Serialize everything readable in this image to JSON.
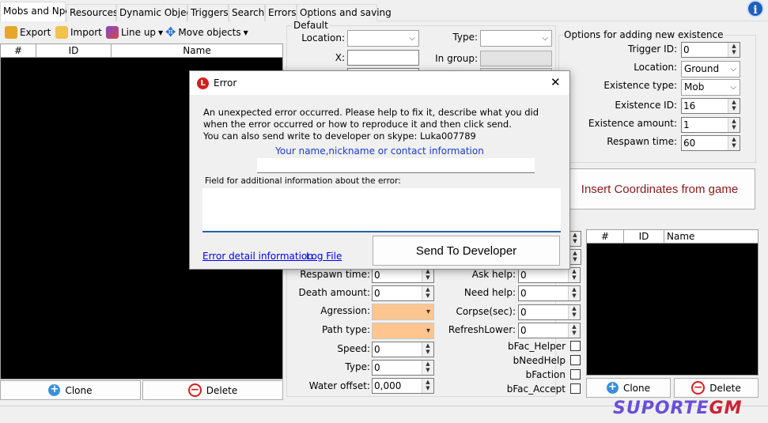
{
  "tabs": [
    {
      "label": "Mobs and Npcs",
      "active": true
    },
    {
      "label": "Resources"
    },
    {
      "label": "Dynamic Objects"
    },
    {
      "label": "Triggers"
    },
    {
      "label": "Search"
    },
    {
      "label": "Errors"
    },
    {
      "label": "Options and saving"
    }
  ],
  "info_icon": "i",
  "toolbar": {
    "export": "Export",
    "import": "Import",
    "line_up": "Line up",
    "move_objects": "Move objects"
  },
  "left_grid": {
    "headers": [
      "#",
      "ID",
      "Name"
    ]
  },
  "left_buttons": {
    "clone": "Clone",
    "delete": "Delete"
  },
  "default_group": {
    "title": "Default",
    "location_label": "Location:",
    "x_label": "X:",
    "type_label": "Type:",
    "in_group_label": "In group:"
  },
  "options_group": {
    "title": "Options for adding new existence",
    "trigger_id_label": "Trigger ID:",
    "trigger_id": "0",
    "location_label": "Location:",
    "location": "Ground",
    "existence_type_label": "Existence type:",
    "existence_type": "Mob",
    "existence_id_label": "Existence ID:",
    "existence_id": "16",
    "existence_amount_label": "Existence amount:",
    "existence_amount": "1",
    "respawn_time_label": "Respawn time:",
    "respawn_time": "60"
  },
  "insert_button": "Insert Coordinates from game",
  "right_grid": {
    "headers": [
      "#",
      "ID",
      "Name"
    ]
  },
  "right_buttons": {
    "clone": "Clone",
    "delete": "Delete"
  },
  "fields_left": {
    "respawn_time_label": "Respawn time:",
    "respawn_time": "0",
    "death_amount_label": "Death amount:",
    "death_amount": "0",
    "agression_label": "Agression:",
    "path_type_label": "Path type:",
    "speed_label": "Speed:",
    "speed": "0",
    "type_label": "Type:",
    "type": "0",
    "water_offset_label": "Water offset:",
    "water_offset": "0,000"
  },
  "fields_right": {
    "ask_help_label": "Ask help:",
    "ask_help": "0",
    "need_help_label": "Need help:",
    "need_help": "0",
    "corpse_label": "Corpse(sec):",
    "corpse": "0",
    "refresh_lower_label": "RefreshLower:",
    "refresh_lower": "0",
    "bfac_helper": "bFac_Helper",
    "bneed_help": "bNeedHelp",
    "bfaction": "bFaction",
    "bfac_accept": "bFac_Accept"
  },
  "dialog": {
    "title": "Error",
    "close": "✕",
    "message_line1": "An unexpected error occurred. Please help to fix it, describe what you did",
    "message_line2": "when the error occurred or how to reproduce it and then click send.",
    "message_line3": "You can also send write to developer on skype: Luka007789",
    "contact_label": "Your name,nickname or contact information",
    "additional_label": "Field for additional information about the error:",
    "error_detail_link": "Error detail information",
    "log_file_link": "Log File",
    "send_button": "Send To Developer"
  },
  "watermark": {
    "part1": "SUPORTE",
    "part2": "GM"
  },
  "colors": {
    "accent_orange": "#ffc58f",
    "link_blue": "#0000ee",
    "insert_text": "#8b1a1a",
    "grid_bg": "#000000"
  }
}
